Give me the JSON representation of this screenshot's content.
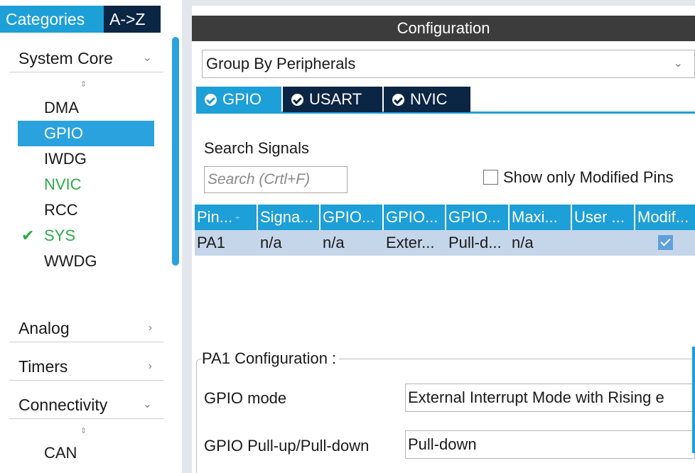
{
  "sidebar": {
    "tabs": {
      "categories": "Categories",
      "az": "A->Z"
    },
    "sections": [
      {
        "label": "System Core",
        "chevron": "chevron-down"
      },
      {
        "label": "Analog",
        "chevron": "chevron-right"
      },
      {
        "label": "Timers",
        "chevron": "chevron-right"
      },
      {
        "label": "Connectivity",
        "chevron": "chevron-down"
      }
    ],
    "system_core_items": [
      {
        "label": "DMA",
        "state": "normal"
      },
      {
        "label": "GPIO",
        "state": "selected"
      },
      {
        "label": "IWDG",
        "state": "normal"
      },
      {
        "label": "NVIC",
        "state": "green"
      },
      {
        "label": "RCC",
        "state": "normal"
      },
      {
        "label": "SYS",
        "state": "checked"
      },
      {
        "label": "WWDG",
        "state": "normal"
      }
    ],
    "connectivity_items": [
      {
        "label": "CAN"
      }
    ],
    "check_glyph": "✔",
    "sort_glyph": "÷"
  },
  "config": {
    "title": "Configuration",
    "group_by": "Group By Peripherals",
    "tabs": [
      {
        "label": "GPIO",
        "active": true
      },
      {
        "label": "USART",
        "active": false
      },
      {
        "label": "NVIC",
        "active": false
      }
    ],
    "search": {
      "label": "Search Signals",
      "placeholder": "Search (Crtl+F)"
    },
    "show_modified_label": "Show only Modified Pins",
    "table": {
      "headers": [
        "Pin...",
        "Signa...",
        "GPIO...",
        "GPIO...",
        "GPIO...",
        "Maxi...",
        "User ...",
        "Modif..."
      ],
      "rows": [
        {
          "pin": "PA1",
          "signal": "n/a",
          "gpio_output": "n/a",
          "gpio_mode": "Exter...",
          "gpio_pull": "Pull-d...",
          "max_speed": "n/a",
          "user_label": "",
          "modified": true
        }
      ]
    },
    "pin_config": {
      "title": "PA1 Configuration :",
      "fields": [
        {
          "label": "GPIO mode",
          "value": "External Interrupt Mode with Rising e"
        },
        {
          "label": "GPIO Pull-up/Pull-down",
          "value": "Pull-down"
        }
      ]
    }
  },
  "colors": {
    "accent_blue": "#1d9fd8",
    "dark_navy": "#0b2545",
    "header_dark": "#3c3c3c",
    "row_selected": "#c6d6ea",
    "green": "#2eaa4a"
  }
}
